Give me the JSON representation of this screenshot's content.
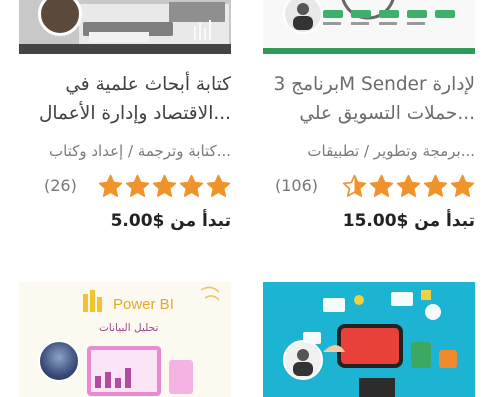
{
  "cards": [
    {
      "title_line1": "كتابة أبحاث علمية في",
      "title_line2": "الاقتصاد وإدارة الأعمال...",
      "category": "كتابة وترجمة / إعداد وكتاب...",
      "rating": 5,
      "reviews": "(26)",
      "price": "تبدأ من $5.00"
    },
    {
      "title_line1": "برنامج 3M Sender لإدارة",
      "title_line2": "حملات التسويق علي...",
      "category": "برمجة وتطوير / تطبيقات...",
      "rating": 4.5,
      "reviews": "(106)",
      "price": "تبدأ من $15.00"
    }
  ],
  "thumb_bottom_left": {
    "brand": "Power BI",
    "subtitle": "تحليل البيانات"
  },
  "colors": {
    "star": "#f0932b",
    "teal_bg": "#22b5d2",
    "green_bar": "#3db06a"
  }
}
